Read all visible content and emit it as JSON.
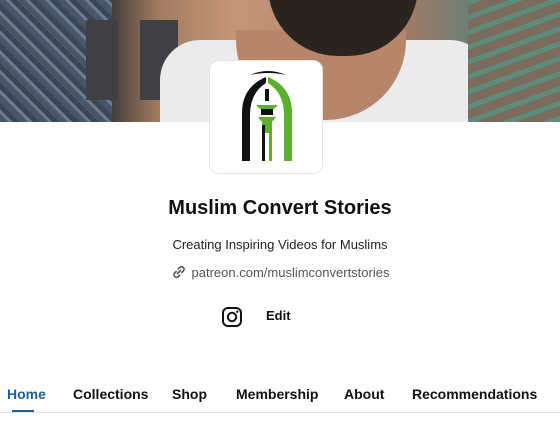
{
  "cover": {
    "alt_description_icon": "cover-photo"
  },
  "profile": {
    "name": "Muslim Convert Stories",
    "tagline": "Creating Inspiring Videos for Muslims",
    "link": "patreon.com/muslimconvertstories"
  },
  "actions": {
    "instagram_icon": "instagram-icon",
    "edit_label": "Edit"
  },
  "tabs": [
    {
      "label": "Home",
      "active": true
    },
    {
      "label": "Collections",
      "active": false
    },
    {
      "label": "Shop",
      "active": false
    },
    {
      "label": "Membership",
      "active": false
    },
    {
      "label": "About",
      "active": false
    },
    {
      "label": "Recommendations",
      "active": false
    }
  ],
  "colors": {
    "active_tab": "#1a5f9c",
    "logo_green": "#5bb02d",
    "logo_black": "#111111"
  }
}
